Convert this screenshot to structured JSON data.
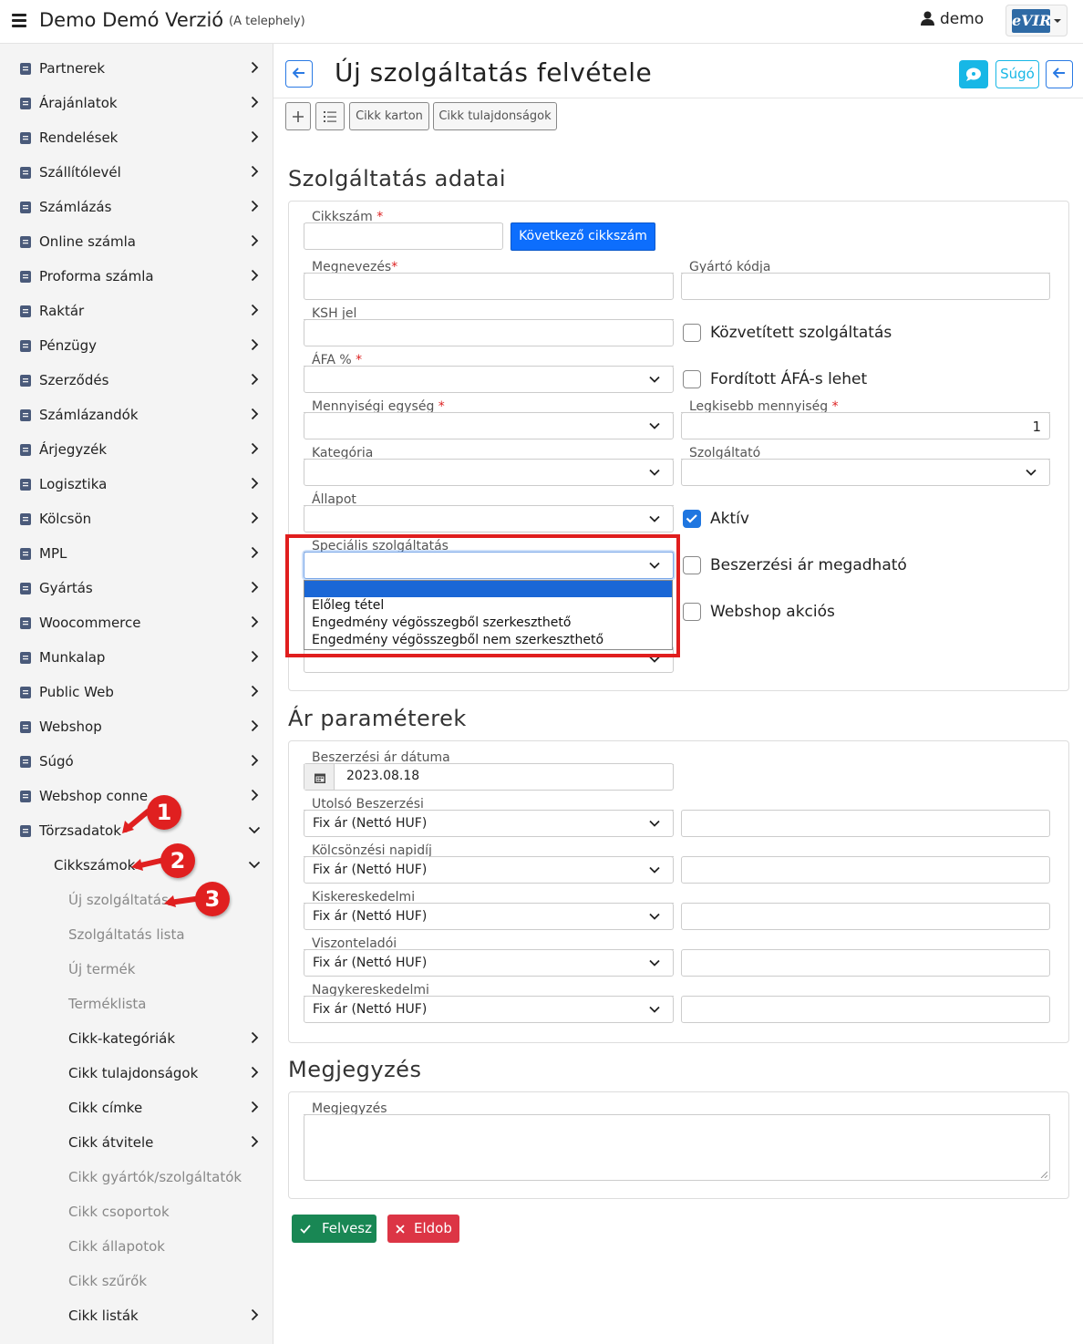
{
  "header": {
    "app_title": "Demo Demó Verzió",
    "site": "(A telephely)",
    "user": "demo",
    "logo_text": "eVIR"
  },
  "sidebar": {
    "items": [
      {
        "label": "Partnerek",
        "icon": "address-book-icon"
      },
      {
        "label": "Árajánlatok",
        "icon": "comments-icon"
      },
      {
        "label": "Rendelések",
        "icon": "file-icon"
      },
      {
        "label": "Szállítólevél",
        "icon": "clipboard-icon"
      },
      {
        "label": "Számlázás",
        "icon": "invoice-icon"
      },
      {
        "label": "Online számla",
        "icon": "globe-icon"
      },
      {
        "label": "Proforma számla",
        "icon": "square-icon"
      },
      {
        "label": "Raktár",
        "icon": "warehouse-icon"
      },
      {
        "label": "Pénzügy",
        "icon": "money-icon"
      },
      {
        "label": "Szerződés",
        "icon": "signature-icon"
      },
      {
        "label": "Számlázandók",
        "icon": "copy-icon"
      },
      {
        "label": "Árjegyzék",
        "icon": "tags-icon"
      },
      {
        "label": "Logisztika",
        "icon": "dolly-icon"
      },
      {
        "label": "Kölcsön",
        "icon": "hand-holding-icon"
      },
      {
        "label": "MPL",
        "icon": "pallet-icon"
      },
      {
        "label": "Gyártás",
        "icon": "cubes-icon"
      },
      {
        "label": "Woocommerce",
        "icon": "wordpress-icon"
      },
      {
        "label": "Munkalap",
        "icon": "file-icon"
      },
      {
        "label": "Public Web",
        "icon": "desktop-icon"
      },
      {
        "label": "Webshop",
        "icon": "cart-icon"
      },
      {
        "label": "Súgó",
        "icon": "question-circle-icon"
      },
      {
        "label": "Webshop conne",
        "icon": "cart-icon"
      },
      {
        "label": "Törzsadatok",
        "icon": "database-icon"
      }
    ],
    "sub_cikkszamok": "Cikkszámok",
    "subitems": [
      {
        "label": "Új szolgáltatás"
      },
      {
        "label": "Szolgáltatás lista"
      },
      {
        "label": "Új termék"
      },
      {
        "label": "Terméklista"
      },
      {
        "label": "Cikk-kategóriák"
      },
      {
        "label": "Cikk tulajdonságok"
      },
      {
        "label": "Cikk címke"
      },
      {
        "label": "Cikk átvitele"
      },
      {
        "label": "Cikk gyártók/szolgáltatók"
      },
      {
        "label": "Cikk csoportok"
      },
      {
        "label": "Cikk állapotok"
      },
      {
        "label": "Cikk szűrők"
      },
      {
        "label": "Cikk listák"
      }
    ]
  },
  "page": {
    "title": "Új szolgáltatás felvétele",
    "help_label": "Súgó",
    "toolbar": {
      "cikk_karton": "Cikk karton",
      "cikk_tulajdonsagok": "Cikk tulajdonságok"
    }
  },
  "service_form": {
    "section_title": "Szolgáltatás adatai",
    "cikkszam_label": "Cikkszám",
    "next_code_button": "Következő cikkszám",
    "megnevezes_label": "Megnevezés",
    "gyarto_kod_label": "Gyártó kódja",
    "ksh_label": "KSH jel",
    "kozvetitett_label": "Közvetített szolgáltatás",
    "afa_label": "ÁFA %",
    "forditott_afa_label": "Fordított ÁFÁ-s lehet",
    "mennyisegi_egyseg_label": "Mennyiségi egység",
    "legkisebb_mennyiseg_label": "Legkisebb mennyiség",
    "legkisebb_mennyiseg_value": "1",
    "kategoria_label": "Kategória",
    "szolgaltato_label": "Szolgáltató",
    "allapot_label": "Állapot",
    "aktiv_label": "Aktív",
    "aktiv_checked": true,
    "specialis_label": "Speciális szolgáltatás",
    "specialis_value": "",
    "specialis_options": [
      "",
      "Előleg tétel",
      "Engedmény végösszegből szerkeszthető",
      "Engedmény végösszegből nem szerkeszthető"
    ],
    "beszerzesi_ar_label": "Beszerzési ár megadható",
    "webshop_akcios_label": "Webshop akciós"
  },
  "price_params": {
    "section_title": "Ár paraméterek",
    "date_label": "Beszerzési ár dátuma",
    "date_value": "2023.08.18",
    "rows": [
      {
        "label": "Utolsó Beszerzési",
        "select": "Fix ár (Nettó HUF)",
        "value": ""
      },
      {
        "label": "Kölcsönzési napidíj",
        "select": "Fix ár (Nettó HUF)",
        "value": ""
      },
      {
        "label": "Kiskereskedelmi",
        "select": "Fix ár (Nettó HUF)",
        "value": ""
      },
      {
        "label": "Viszonteladói",
        "select": "Fix ár (Nettó HUF)",
        "value": ""
      },
      {
        "label": "Nagykereskedelmi",
        "select": "Fix ár (Nettó HUF)",
        "value": ""
      }
    ]
  },
  "notes": {
    "section_title": "Megjegyzés",
    "label": "Megjegyzés",
    "value": ""
  },
  "actions": {
    "save": "Felvesz",
    "discard": "Eldob"
  },
  "annotations": [
    "1",
    "2",
    "3"
  ],
  "colors": {
    "primary": "#0d6efd",
    "info": "#17b7e6",
    "success": "#198754",
    "danger": "#dc3545",
    "highlight": "#e01e1e"
  }
}
